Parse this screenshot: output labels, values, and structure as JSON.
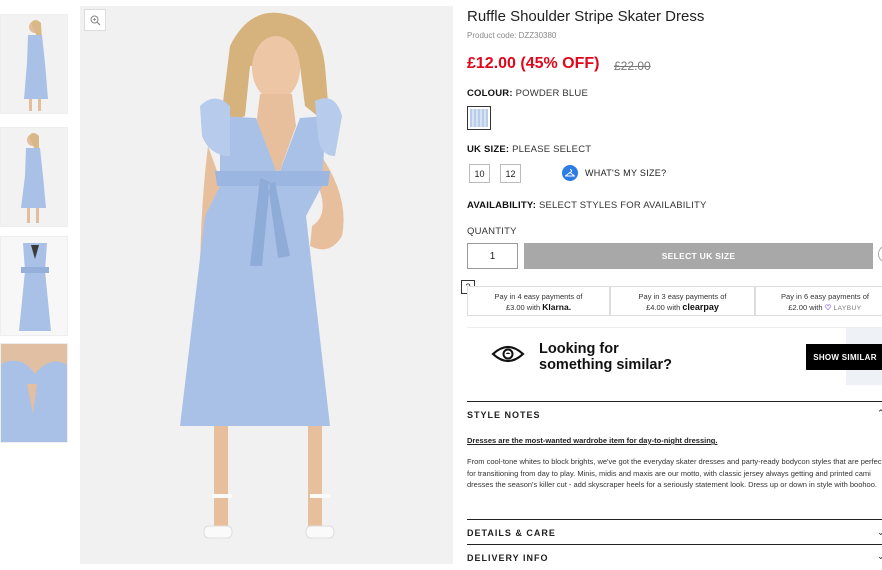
{
  "product": {
    "title": "Ruffle Shoulder Stripe Skater Dress",
    "code": "Product code: DZZ30380",
    "price": "£12.00 (45% OFF)",
    "old_price": "£22.00"
  },
  "colour": {
    "label": "COLOUR:",
    "value": "POWDER BLUE"
  },
  "size": {
    "label": "UK SIZE:",
    "value": "PLEASE SELECT",
    "options": [
      "10",
      "12"
    ],
    "whats_my_size": "WHAT'S MY SIZE?"
  },
  "availability": {
    "label": "AVAILABILITY:",
    "value": "SELECT STYLES FOR AVAILABILITY"
  },
  "quantity": {
    "label": "QUANTITY",
    "value": "1"
  },
  "select_button": "SELECT UK SIZE",
  "help_mark": "?",
  "payments": [
    {
      "line1": "Pay in 4 easy payments of",
      "amount": "£3.00 with",
      "brand": "Klarna."
    },
    {
      "line1": "Pay in 3 easy payments of",
      "amount": "£4.00 with",
      "brand": "clearpay"
    },
    {
      "line1": "Pay in 6 easy payments of",
      "amount": "£2.00 with",
      "brand": "LAYBUY"
    }
  ],
  "similar": {
    "line1": "Looking for",
    "line2": "something similar?",
    "button": "SHOW SIMILAR"
  },
  "style_notes": {
    "heading": "STYLE NOTES",
    "link": "Dresses are the most-wanted wardrobe item for day-to-night dressing.",
    "body": "From cool-tone whites to block brights, we've got the everyday skater dresses and party-ready bodycon styles that are perfect for transitioning from day to play. Minis, midis and maxis are our motto, with classic jersey always getting and printed cami dresses the season's killer cut - add skyscraper heels for a seriously statement look. Dress up or down in style with boohoo."
  },
  "details_heading": "DETAILS & CARE",
  "delivery_heading": "DELIVERY INFO",
  "icons": [
    "zoom-icon",
    "hanger-icon",
    "eye-icon",
    "chevron-up-icon",
    "chevron-down-icon",
    "heart-icon"
  ],
  "colors": {
    "price_red": "#e0061b",
    "button_grey": "#a8a8a8",
    "dress_blue": "#a9c1e6",
    "klarna_blue": "#2d7be5"
  }
}
